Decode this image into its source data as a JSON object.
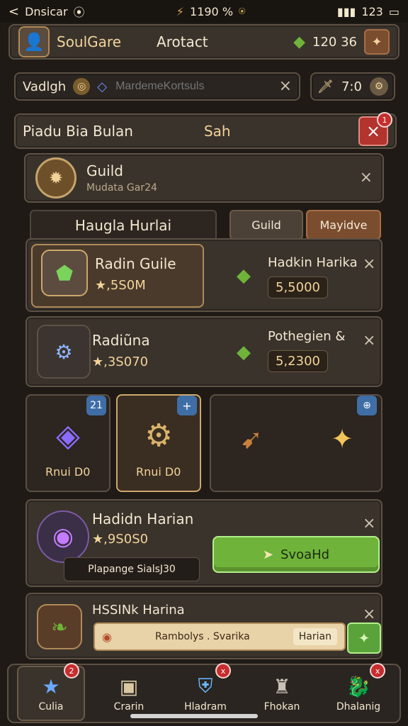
{
  "status": {
    "left": "Dnsicar",
    "center": "1190 %",
    "right": "123"
  },
  "header": {
    "title1": "SoulGare",
    "title2": "Arotact",
    "gems": "120 36"
  },
  "search": {
    "left": "Vadlgh",
    "placeholder": "MardemeKortsuls",
    "count": "7:0"
  },
  "breadcrumb": {
    "left": "Piadu Bia Bulan",
    "right": "Sah"
  },
  "guild_header": {
    "title": "Guild",
    "subtitle": "Mudata Gar24"
  },
  "section": {
    "title": "Haugla Hurlai",
    "tab_guild": "Guild",
    "tab_active": "Mayidve"
  },
  "cards": [
    {
      "name": "Radin Guile",
      "value": "★,5S0M",
      "right_name": "Hadkin Harika",
      "right_value": "5,5000"
    },
    {
      "name": "Radiũna",
      "value": "★,3S070",
      "right_name": "Pothegien &",
      "right_value": "5,2300"
    }
  ],
  "slots": [
    {
      "label": "Rnui D0",
      "corner": "21"
    },
    {
      "label": "Rnui D0",
      "corner": "+"
    },
    {
      "label": "",
      "corner": "⊕"
    }
  ],
  "bottom_card": {
    "name": "Hadidn Harian",
    "value": "★,9S0S0",
    "chip": "Plapange SialsJ30",
    "button": "SvoaHd"
  },
  "last_card": {
    "name": "HSSINk Harina",
    "chip": "Rambolys . Svarika",
    "tag": "Harian"
  },
  "nav": [
    {
      "label": "Culia",
      "badge": "2"
    },
    {
      "label": "Crarin",
      "badge": ""
    },
    {
      "label": "Hladram",
      "badge": "x"
    },
    {
      "label": "Fhokan",
      "badge": ""
    },
    {
      "label": "Dhalanig",
      "badge": "x"
    }
  ],
  "colors": {
    "accent": "#f2d39a",
    "danger": "#c62d2d",
    "green": "#6fb33a"
  }
}
